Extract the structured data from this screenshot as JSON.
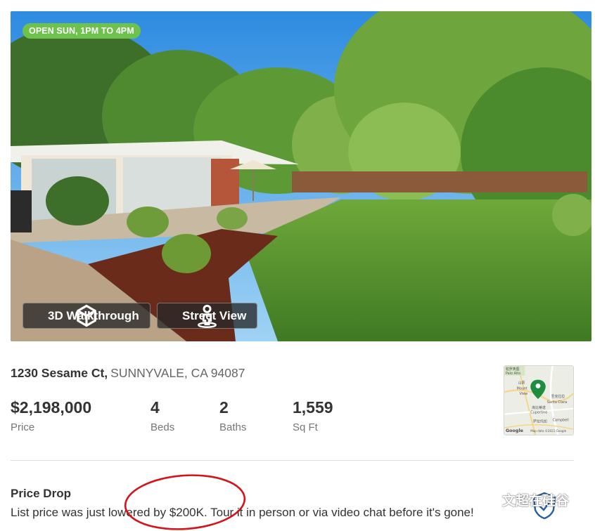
{
  "listing": {
    "open_house_badge": "OPEN SUN, 1PM TO 4PM",
    "buttons": {
      "walkthrough_label": "3D Walkthrough",
      "street_view_label": "Street View"
    },
    "address": {
      "street": "1230 Sesame Ct,",
      "city": "SUNNYVALE, CA 94087"
    },
    "stats": {
      "price": {
        "value": "$2,198,000",
        "label": "Price"
      },
      "beds": {
        "value": "4",
        "label": "Beds"
      },
      "baths": {
        "value": "2",
        "label": "Baths"
      },
      "sqft": {
        "value": "1,559",
        "label": "Sq Ft"
      }
    },
    "map": {
      "places": [
        "帕罗奥图",
        "Palo Alto",
        "山景",
        "Mount",
        "View",
        "圣克拉拉",
        "Santa Clara",
        "库比蒂诺",
        "Cupertino",
        "萨拉托加",
        "Campbell"
      ],
      "logo": "Google",
      "attribution": "Map data ©2021 Google"
    },
    "price_drop": {
      "title": "Price Drop",
      "message": "List price was just lowered by $200K. Tour it in person or via video chat before it's gone!"
    }
  },
  "watermark": {
    "text": "文超在硅谷"
  },
  "colors": {
    "badge_green": "#6cc24a",
    "text_dark": "#333333",
    "text_muted": "#767676",
    "annotation_red": "#d4141b",
    "map_pin_green": "#1e8e3e"
  }
}
